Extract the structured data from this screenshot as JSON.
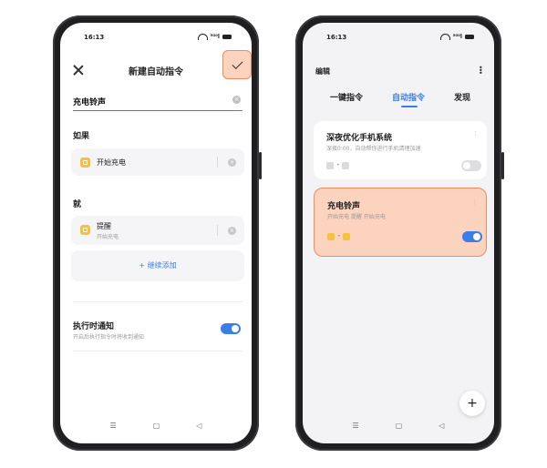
{
  "left_screen": {
    "status": {
      "time": "16:13",
      "signal": "⁵ᴳ⁰l"
    },
    "header": {
      "title": "新建自动指令"
    },
    "name_field": {
      "value": "充电铃声"
    },
    "if_section": {
      "label": "如果",
      "condition": "开始充电"
    },
    "then_section": {
      "label": "就",
      "action_title": "提醒",
      "action_sub": "开始充电",
      "add_label": "+ 继续添加"
    },
    "notify": {
      "title": "执行时通知",
      "subtitle": "开启后执行指令时将收到通知",
      "enabled": true
    },
    "nav": {
      "menu": "☰",
      "home": "▢",
      "back": "◁"
    }
  },
  "right_screen": {
    "status": {
      "time": "16:13",
      "signal": "⁵ᴳ⁰l"
    },
    "edit_label": "编辑",
    "tabs": [
      "一键指令",
      "自动指令",
      "发现"
    ],
    "active_tab": 1,
    "cards": [
      {
        "title": "深夜优化手机系统",
        "subtitle": "深夜0:00，自动帮你进行手机清理加速",
        "enabled": false
      },
      {
        "title": "充电铃声",
        "subtitle": "开始充电  提醒 开始充电",
        "enabled": true
      }
    ],
    "fab": "+",
    "nav": {
      "menu": "☰",
      "home": "▢",
      "back": "◁"
    }
  },
  "colors": {
    "accent": "#3b7ee8",
    "highlight": "#fbd3bf",
    "highlight_border": "#f08c5b",
    "tile": "#f6c23b"
  }
}
